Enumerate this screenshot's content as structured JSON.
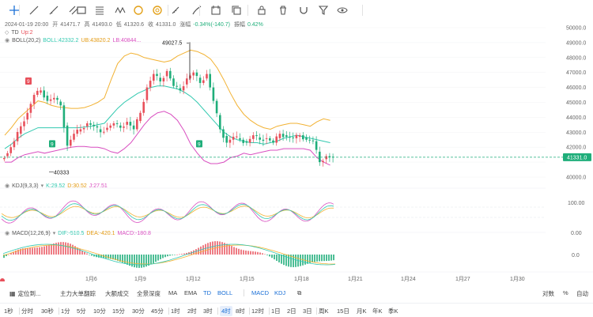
{
  "toolbar": {
    "tools": [
      "crosshair-icon",
      "line-icon",
      "ray-icon",
      "parallel-icon",
      "rect-icon",
      "fib-icon",
      "wave-icon",
      "gann-icon",
      "fib-circle-icon",
      "ruler-icon",
      "brush-icon",
      "capture-icon",
      "copy-icon",
      "lock-icon",
      "delete-icon",
      "magnet-icon",
      "filter-icon",
      "eye-icon"
    ]
  },
  "legend": {
    "date": "2024-01-19 20:00",
    "open_label": "开",
    "open": "41471.7",
    "high_label": "高",
    "high": "41493.0",
    "low_label": "低",
    "low": "41320.6",
    "close_label": "收",
    "close": "41331.0",
    "change_label": "涨幅",
    "change": "-0.34%",
    "change_abs": "(-140.7)",
    "amp_label": "振幅",
    "amp": "0.42%"
  },
  "td": {
    "name": "TD",
    "value": "Up:2"
  },
  "boll": {
    "name": "BOLL(20,2)",
    "boll": "BOLL:42332.2",
    "ub": "UB:43820.2",
    "lb": "LB:40844..."
  },
  "kdj": {
    "name": "KDJ(9,3,3)",
    "k": "K:29.52",
    "d": "D:30.52",
    "j": "J:27.51"
  },
  "macd": {
    "name": "MACD(12,26,9)",
    "dif": "DIF:-510.5",
    "dea": "DEA:-420.1",
    "macd": "MACD:-180.8"
  },
  "price_axis": {
    "ticks": [
      "50000.0",
      "49000.0",
      "48000.0",
      "47000.0",
      "46000.0",
      "45000.0",
      "44000.0",
      "43000.0",
      "42000.0",
      "40000.0"
    ],
    "current": "41331.0",
    "kdj_ticks": [
      "100.00",
      "0.00"
    ],
    "macd_ticks": [
      "0.0"
    ]
  },
  "annotations": {
    "high": "49027.5",
    "low": "40333",
    "td9": "9"
  },
  "date_axis": [
    "1月6",
    "1月9",
    "1月12",
    "1月15",
    "1月18",
    "1月21",
    "1月24",
    "1月27",
    "1月30"
  ],
  "indicator_tabs": {
    "locate": "定位到...",
    "items": [
      "主力大单翻踪",
      "大额成交",
      "全景深度",
      "MA",
      "EMA",
      "TD",
      "BOLL",
      "MACD",
      "KDJ"
    ],
    "right": [
      "对数",
      "%",
      "自动"
    ]
  },
  "periods": [
    "1秒",
    "分时",
    "30秒",
    "1分",
    "5分",
    "10分",
    "15分",
    "30分",
    "45分",
    "1时",
    "2时",
    "3时",
    "4时",
    "8时",
    "12时",
    "1日",
    "2日",
    "3日",
    "周K",
    "15日",
    "月K",
    "年K",
    "季K"
  ],
  "selected_period": "4时",
  "colors": {
    "up": "#e8505b",
    "down": "#1fae7a",
    "boll_mid": "#33c9b0",
    "ub": "#f2b233",
    "lb": "#d94fc0",
    "accent": "#1a6fd6"
  },
  "chart_data": {
    "type": "candlestick",
    "ylim": [
      39500,
      50500
    ],
    "current_price": 41331.0,
    "boll_ub": [
      42800,
      43300,
      43900,
      44300,
      44700,
      45100,
      45000,
      44800,
      44700,
      44650,
      44600,
      44600,
      44650,
      44800,
      45000,
      45300,
      46500,
      47600,
      48100,
      48300,
      48200,
      48000,
      47900,
      47800,
      47700,
      47800,
      48100,
      48300,
      48500,
      48400,
      48200,
      47900,
      47300,
      46500,
      45600,
      44800,
      44200,
      43800,
      43500,
      43300,
      43200,
      43400,
      43500,
      43600,
      43600,
      43500,
      43400,
      43700,
      43900,
      43800
    ],
    "boll_mid": [
      41900,
      42200,
      42600,
      42900,
      43100,
      43300,
      43300,
      43300,
      43300,
      43300,
      43300,
      43300,
      43350,
      43400,
      43500,
      43600,
      44100,
      44600,
      45000,
      45300,
      45600,
      45800,
      46000,
      46100,
      46100,
      46000,
      45900,
      45700,
      45400,
      45000,
      44500,
      44000,
      43500,
      43000,
      42700,
      42500,
      42400,
      42300,
      42300,
      42200,
      42300,
      42400,
      42600,
      42700,
      42800,
      42700,
      42600,
      42500,
      42400,
      42300
    ],
    "boll_lb": [
      41000,
      41000,
      41300,
      41500,
      41600,
      41700,
      41600,
      41700,
      41800,
      41900,
      42000,
      42050,
      42050,
      42000,
      42000,
      41900,
      41700,
      41600,
      41900,
      42300,
      42900,
      43500,
      44000,
      44300,
      44400,
      44200,
      43800,
      43100,
      42200,
      41600,
      41100,
      40900,
      40900,
      41000,
      41300,
      41400,
      41600,
      41500,
      41600,
      41700,
      41800,
      41800,
      41900,
      41900,
      41900,
      41900,
      41800,
      41300,
      41000,
      40800
    ],
    "closes": [
      41600,
      42400,
      43400,
      44300,
      45500,
      45800,
      45100,
      45300,
      44800,
      42100,
      42900,
      43200,
      43600,
      43400,
      43000,
      43300,
      43600,
      43300,
      43700,
      43200,
      44300,
      46000,
      46900,
      46400,
      47100,
      46100,
      45800,
      46600,
      47000,
      46300,
      46900,
      45100,
      43200,
      42300,
      42700,
      42500,
      42300,
      42800,
      42500,
      42600,
      42300,
      42900,
      42700,
      42600,
      42800,
      42500,
      42400,
      41000,
      41400,
      41331
    ]
  }
}
